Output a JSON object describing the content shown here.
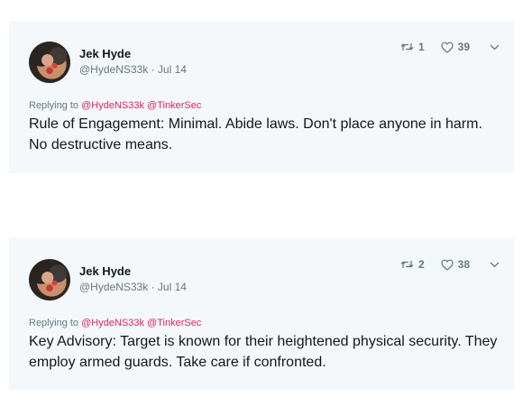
{
  "tweets": [
    {
      "author": "Jek Hyde",
      "handle": "@HydeNS33k",
      "separator": "·",
      "date": "Jul 14",
      "reply_prefix": "Replying to",
      "reply_mentions": [
        "@HydeNS33k",
        "@TinkerSec"
      ],
      "text": "Rule of Engagement: Minimal. Abide laws. Don't place anyone in harm. No destructive means.",
      "retweets": "1",
      "likes": "39"
    },
    {
      "author": "Jek Hyde",
      "handle": "@HydeNS33k",
      "separator": "·",
      "date": "Jul 14",
      "reply_prefix": "Replying to",
      "reply_mentions": [
        "@HydeNS33k",
        "@TinkerSec"
      ],
      "text": "Key Advisory: Target is known for their heightened physical security. They employ armed guards. Take care if confronted.",
      "retweets": "2",
      "likes": "38"
    }
  ],
  "colors": {
    "card_bg": "#f5f8fa",
    "mention": "#e0245e",
    "secondary_text": "#657786"
  },
  "icons": {
    "retweet": "retweet-icon",
    "like": "heart-icon",
    "menu": "chevron-down-icon"
  }
}
